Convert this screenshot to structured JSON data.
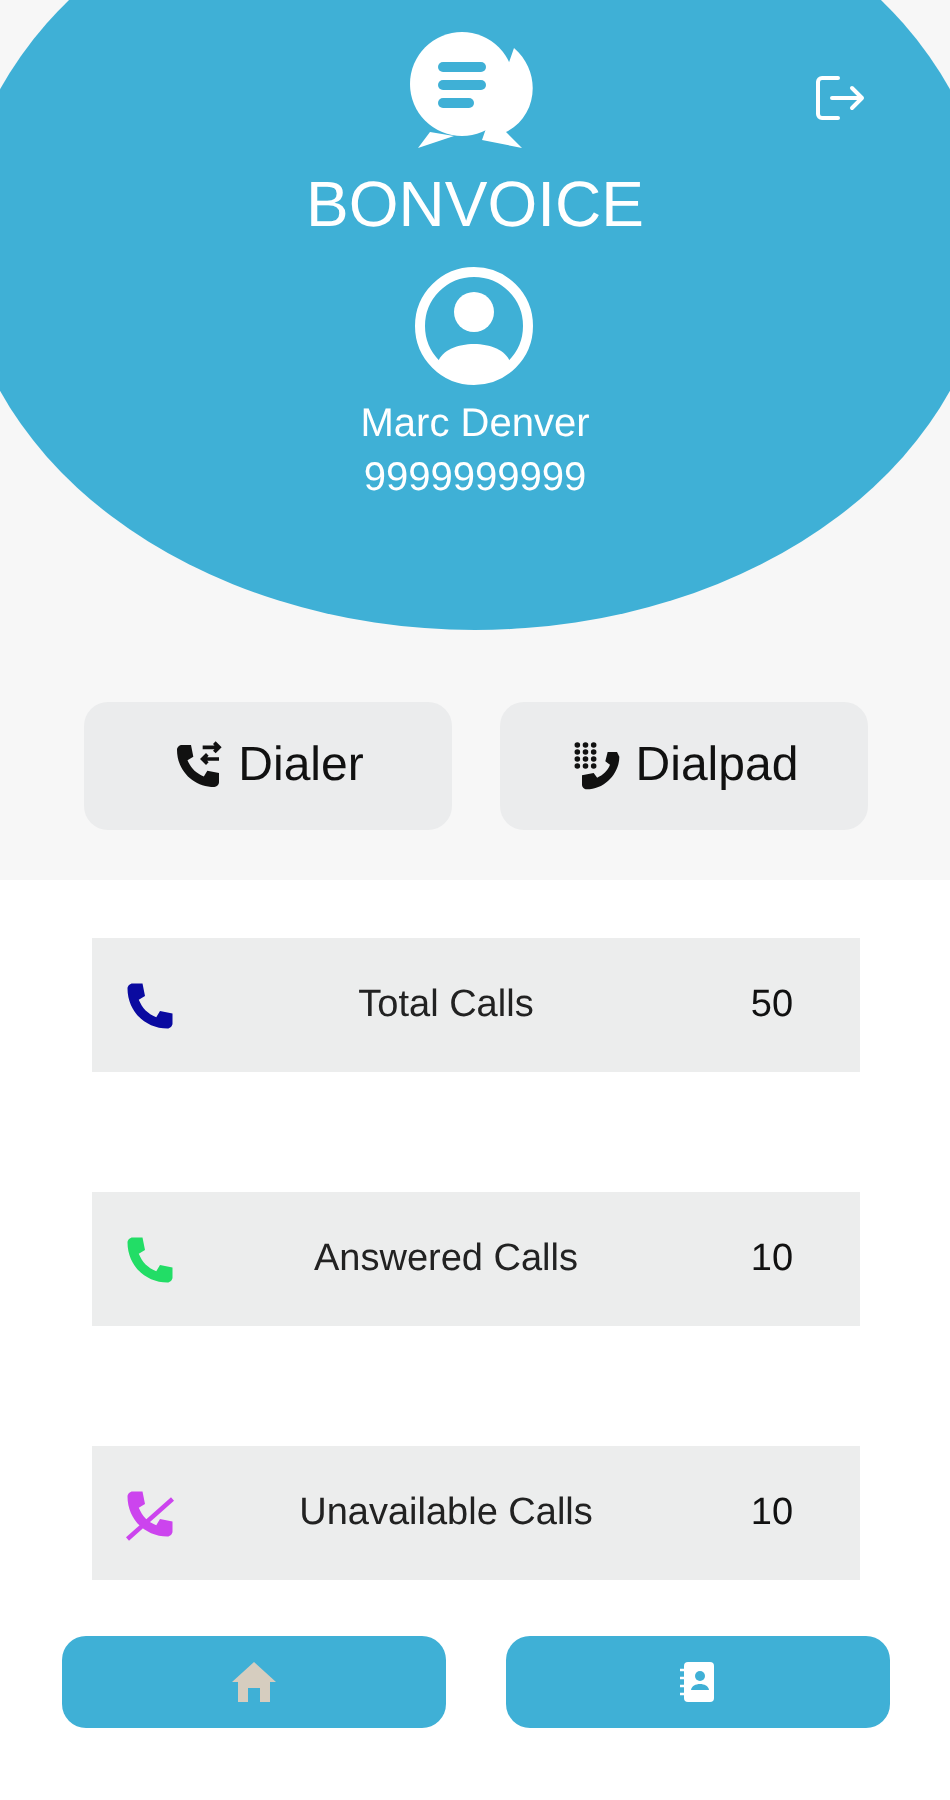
{
  "header": {
    "app_name": "BONVOICE",
    "user_name": "Marc Denver",
    "phone": "9999999999"
  },
  "actions": [
    {
      "kind": "dialer",
      "label": "Dialer"
    },
    {
      "kind": "dialpad",
      "label": "Dialpad"
    }
  ],
  "stats": [
    {
      "kind": "total",
      "label": "Total Calls",
      "count": "50",
      "color": "#0a0aa0"
    },
    {
      "kind": "answered",
      "label": "Answered Calls",
      "count": "10",
      "color": "#22dd66"
    },
    {
      "kind": "unavailable",
      "label": "Unavailable Calls",
      "count": "10",
      "color": "#cc44ee"
    }
  ],
  "nav": [
    {
      "kind": "home",
      "selected": true
    },
    {
      "kind": "contacts",
      "selected": false
    }
  ]
}
